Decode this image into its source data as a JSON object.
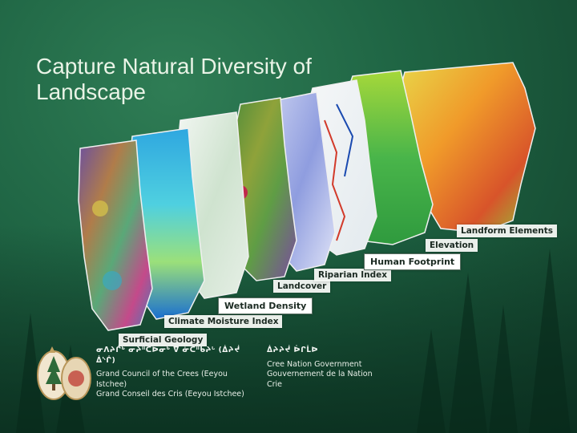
{
  "slide": {
    "title": "Capture Natural Diversity of Landscape"
  },
  "layers": [
    {
      "id": "surficial",
      "label": "Surficial Geology"
    },
    {
      "id": "climate",
      "label": "Climate Moisture Index"
    },
    {
      "id": "wetland",
      "label": "Wetland Density"
    },
    {
      "id": "landcover",
      "label": "Landcover"
    },
    {
      "id": "riparian",
      "label": "Riparian Index"
    },
    {
      "id": "human",
      "label": "Human Footprint"
    },
    {
      "id": "elevation",
      "label": "Elevation"
    },
    {
      "id": "landform",
      "label": "Landform Elements"
    }
  ],
  "org_left": {
    "syllabics": "ᓂᐱᔨᒌᒃ ᓂᔨᐦᑖᐅᓂᒃ ᐁ ᓃᑖᐦᑲᔨᒡ (ᐄᔨᔫ ᐄᔅᒌ)",
    "line1": "Grand Council of the Crees (Eeyou Istchee)",
    "line2": "Grand Conseil des Cris (Eeyou Istchee)"
  },
  "org_right": {
    "syllabics": "ᐄᔨᔨᔫ ᐆᒋᒫᐅ",
    "line1": "Cree Nation Government",
    "line2": "Gouvernement de la Nation Crie"
  },
  "colors": {
    "background": "#1f6544",
    "title": "#e9f3e6"
  }
}
